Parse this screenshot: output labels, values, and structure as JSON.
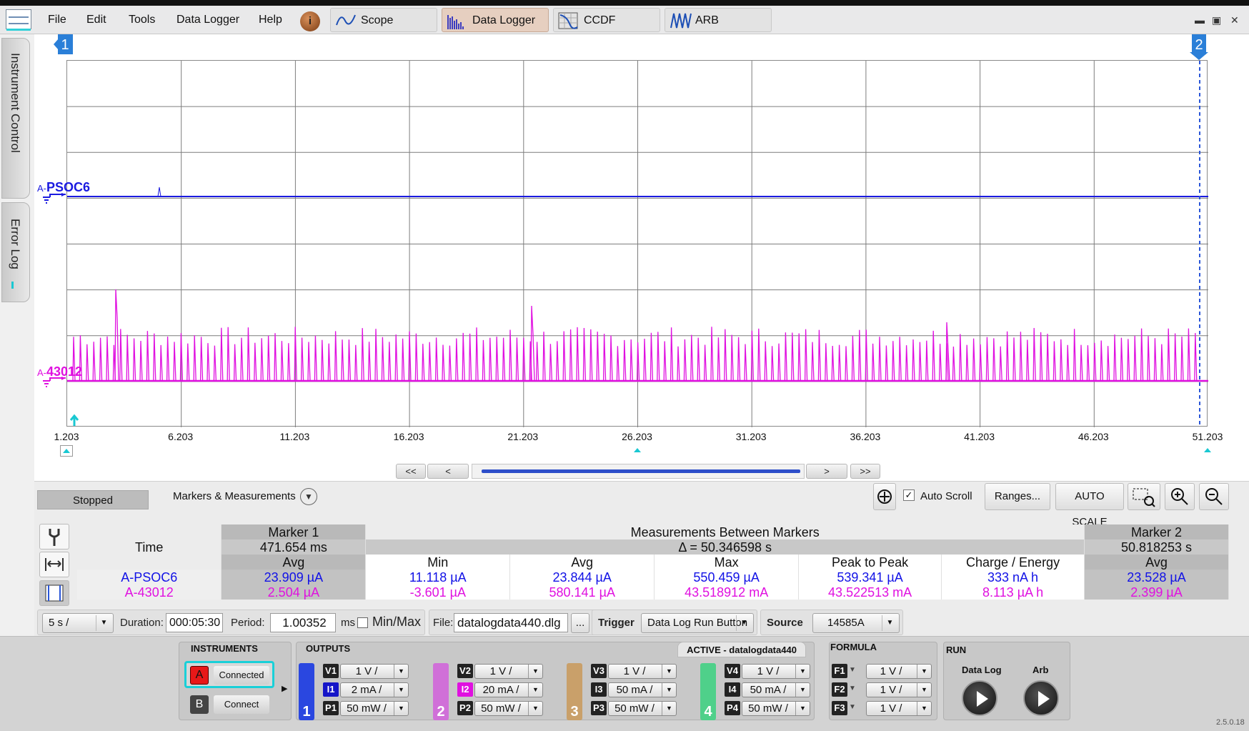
{
  "menu": {
    "file": "File",
    "edit": "Edit",
    "tools": "Tools",
    "data_logger": "Data Logger",
    "help": "Help"
  },
  "tabs": {
    "scope": "Scope",
    "data_logger": "Data Logger",
    "ccdf": "CCDF",
    "arb": "ARB"
  },
  "window_controls": {
    "minimize": "▬",
    "maximize": "▣",
    "close": "✕"
  },
  "side_tabs": {
    "instrument_control": "Instrument Control",
    "error_log": "Error Log"
  },
  "markers": {
    "m1": "1",
    "m2": "2"
  },
  "traces": {
    "a": {
      "prefix": "A-",
      "name": "PSOC6",
      "color": "#1a1ae0"
    },
    "b": {
      "prefix": "A-",
      "name": "43012",
      "color": "#e010e0"
    }
  },
  "x_ticks": [
    "1.203",
    "6.203",
    "11.203",
    "16.203",
    "21.203",
    "26.203",
    "31.203",
    "36.203",
    "41.203",
    "46.203",
    "51.203"
  ],
  "nav": {
    "first": "<<",
    "prev": "<",
    "next": ">",
    "last": ">>"
  },
  "status": "Stopped",
  "measurements_title": "Markers & Measurements",
  "toolbar": {
    "auto_scroll": "Auto Scroll",
    "ranges": "Ranges...",
    "auto_scale": "AUTO SCALE"
  },
  "table": {
    "marker1": "Marker 1",
    "between": "Measurements Between Markers",
    "marker2": "Marker 2",
    "time_label": "Time",
    "m1_time": "471.654 ms",
    "delta": "Δ = 50.346598 s",
    "m2_time": "50.818253 s",
    "cols": {
      "avg": "Avg",
      "min": "Min",
      "avg2": "Avg",
      "max": "Max",
      "p2p": "Peak to Peak",
      "charge": "Charge / Energy",
      "avg3": "Avg"
    },
    "rows": [
      {
        "name": "A-PSOC6",
        "m1avg": "23.909 µA",
        "min": "11.118 µA",
        "avg": "23.844 µA",
        "max": "550.459 µA",
        "p2p": "539.341 µA",
        "charge": "333 nA h",
        "m2avg": "23.528 µA"
      },
      {
        "name": "A-43012",
        "m1avg": "2.504 µA",
        "min": "-3.601 µA",
        "avg": "580.141 µA",
        "max": "43.518912 mA",
        "p2p": "43.522513 mA",
        "charge": "8.113 µA h",
        "m2avg": "2.399 µA"
      }
    ]
  },
  "config": {
    "timebase": "5 s /",
    "duration_label": "Duration:",
    "duration": "000:05:30",
    "period_label": "Period:",
    "period": "1.00352",
    "period_unit": "ms",
    "minmax": "Min/Max",
    "file_label": "File:",
    "file": "datalogdata440.dlg",
    "browse": "...",
    "trigger_label": "Trigger",
    "trigger": "Data Log Run Button",
    "source_label": "Source",
    "source": "14585A"
  },
  "bottom": {
    "instruments_title": "INSTRUMENTS",
    "a_letter": "A",
    "a_status": "Connected",
    "b_letter": "B",
    "b_status": "Connect",
    "outputs_title": "OUTPUTS",
    "active_title": "ACTIVE - datalogdata440",
    "formula_title": "FORMULA",
    "run_title": "RUN",
    "run_datalog": "Data Log",
    "run_arb": "Arb",
    "channels": [
      {
        "num": "1",
        "color": "#2a47e0",
        "v": "V1",
        "i": "I1",
        "p": "P1",
        "vval": "1 V /",
        "ival": "2 mA /",
        "pval": "50 mW /"
      },
      {
        "num": "2",
        "color": "#d070d8",
        "v": "V2",
        "i": "I2",
        "p": "P2",
        "vval": "1 V /",
        "ival": "20 mA /",
        "pval": "50 mW /"
      },
      {
        "num": "3",
        "color": "#c9a06a",
        "v": "V3",
        "i": "I3",
        "p": "P3",
        "vval": "1 V /",
        "ival": "50 mA /",
        "pval": "50 mW /"
      },
      {
        "num": "4",
        "color": "#4fd08a",
        "v": "V4",
        "i": "I4",
        "p": "P4",
        "vval": "1 V /",
        "ival": "50 mA /",
        "pval": "50 mW /"
      }
    ],
    "formulas": [
      {
        "tag": "F1",
        "val": "1 V /"
      },
      {
        "tag": "F2",
        "val": "1 V /"
      },
      {
        "tag": "F3",
        "val": "1 V /"
      }
    ],
    "version": "2.5.0.18"
  }
}
